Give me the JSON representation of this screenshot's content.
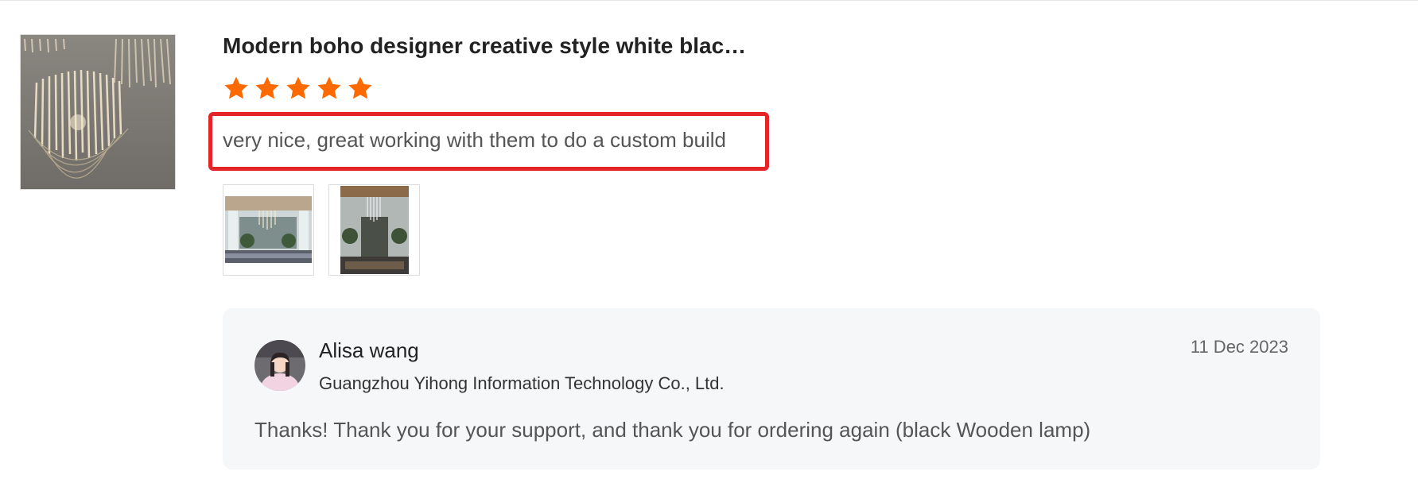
{
  "product": {
    "title": "Modern boho designer creative style white blac…",
    "thumbnail_icon": "chandelier-photo"
  },
  "rating": {
    "stars": 5,
    "max": 5,
    "color": "#ff6a00"
  },
  "review": {
    "text": "very nice, great working with them to do a custom build",
    "highlight_color": "#e32428",
    "images": [
      {
        "name": "review-photo-lobby"
      },
      {
        "name": "review-photo-entrance"
      }
    ]
  },
  "reply": {
    "name": "Alisa wang",
    "company": "Guangzhou Yihong Information Technology Co., Ltd.",
    "date": "11 Dec 2023",
    "text": "Thanks! Thank you for your support, and thank you for ordering again (black Wooden lamp)"
  }
}
